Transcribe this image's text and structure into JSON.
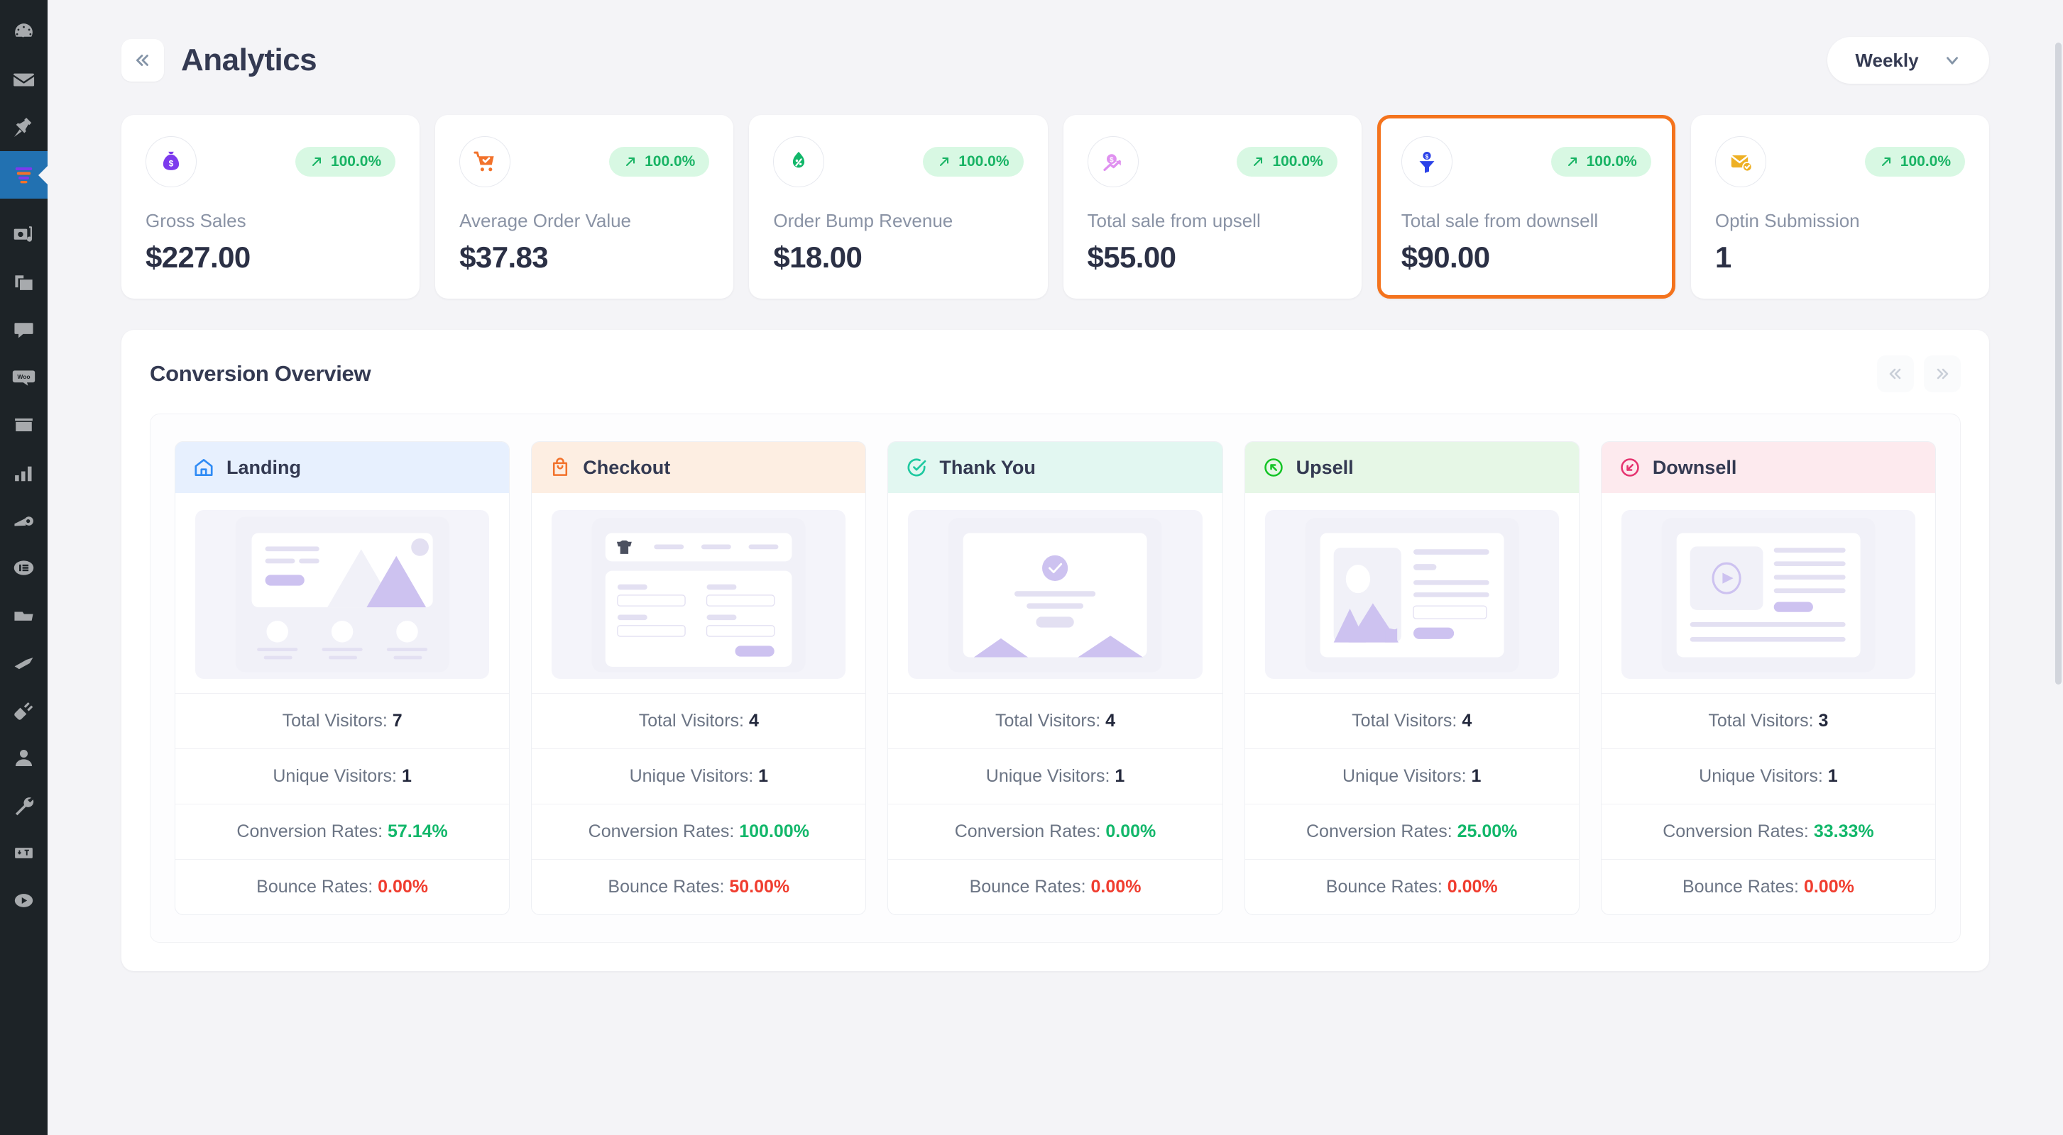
{
  "wp_sidebar": {
    "items": [
      {
        "name": "dashboard-icon",
        "active": false
      },
      {
        "name": "mail-icon",
        "active": false
      },
      {
        "name": "pin-icon",
        "active": false
      },
      {
        "name": "funnel-icon",
        "active": true
      },
      {
        "name": "media-icon",
        "active": false
      },
      {
        "name": "pages-icon",
        "active": false
      },
      {
        "name": "comments-icon",
        "active": false
      },
      {
        "name": "woo-icon",
        "active": false
      },
      {
        "name": "products-icon",
        "active": false
      },
      {
        "name": "analytics-icon",
        "active": false
      },
      {
        "name": "marketing-icon",
        "active": false
      },
      {
        "name": "elementor-icon",
        "active": false
      },
      {
        "name": "templates-icon",
        "active": false
      },
      {
        "name": "appearance-icon",
        "active": false
      },
      {
        "name": "plugins-icon",
        "active": false
      },
      {
        "name": "users-icon",
        "active": false
      },
      {
        "name": "tools-icon",
        "active": false
      },
      {
        "name": "settings-icon",
        "active": false
      },
      {
        "name": "play-icon",
        "active": false
      }
    ]
  },
  "header": {
    "title": "Analytics",
    "collapse_icon": "chevrons-left-icon",
    "period": {
      "value": "Weekly",
      "chevron_icon": "chevron-down-icon"
    }
  },
  "stats": {
    "cards": [
      {
        "label": "Gross Sales",
        "value": "$227.00",
        "badge": "100.0%",
        "badge_icon": "trend-up-icon",
        "icon": "money-bag-icon",
        "icon_color": "#7c3aed",
        "highlighted": false
      },
      {
        "label": "Average Order Value",
        "value": "$37.83",
        "badge": "100.0%",
        "badge_icon": "trend-up-icon",
        "icon": "cart-check-icon",
        "icon_color": "#f2722b",
        "highlighted": false
      },
      {
        "label": "Order Bump Revenue",
        "value": "$18.00",
        "badge": "100.0%",
        "badge_icon": "trend-up-icon",
        "icon": "leaf-percent-icon",
        "icon_color": "#12b76a",
        "highlighted": false
      },
      {
        "label": "Total sale from upsell",
        "value": "$55.00",
        "badge": "100.0%",
        "badge_icon": "trend-up-icon",
        "icon": "coin-trend-up-icon",
        "icon_color": "#e091f0",
        "highlighted": false
      },
      {
        "label": "Total sale from downsell",
        "value": "$90.00",
        "badge": "100.0%",
        "badge_icon": "trend-up-icon",
        "icon": "funnel-dollar-icon",
        "icon_color": "#2b42e8",
        "highlighted": true
      },
      {
        "label": "Optin Submission",
        "value": "1",
        "badge": "100.0%",
        "badge_icon": "trend-up-icon",
        "icon": "mail-check-icon",
        "icon_color": "#eeb024",
        "highlighted": false
      }
    ]
  },
  "conversion": {
    "title": "Conversion Overview",
    "nav": {
      "prev_icon": "chevrons-left-icon",
      "next_icon": "chevrons-right-icon"
    },
    "stat_labels": {
      "total_visitors": "Total Visitors:",
      "unique_visitors": "Unique Visitors:",
      "conversion_rates": "Conversion Rates:",
      "bounce_rates": "Bounce Rates:"
    },
    "steps": [
      {
        "label": "Landing",
        "icon": "home-icon",
        "accent": "#2f8bf5",
        "header_bg": "#e7f0fe",
        "thumb": "landing-wireframe",
        "total_visitors": "7",
        "unique_visitors": "1",
        "conversion_rate": "57.14%",
        "bounce_rate": "0.00%"
      },
      {
        "label": "Checkout",
        "icon": "shopping-bag-icon",
        "accent": "#f2722b",
        "header_bg": "#fdeee2",
        "thumb": "checkout-wireframe",
        "total_visitors": "4",
        "unique_visitors": "1",
        "conversion_rate": "100.00%",
        "bounce_rate": "50.00%"
      },
      {
        "label": "Thank You",
        "icon": "check-circle-icon",
        "accent": "#1ec9a0",
        "header_bg": "#e2f7f1",
        "thumb": "thankyou-wireframe",
        "total_visitors": "4",
        "unique_visitors": "1",
        "conversion_rate": "0.00%",
        "bounce_rate": "0.00%"
      },
      {
        "label": "Upsell",
        "icon": "arrow-up-circle-icon",
        "accent": "#14c426",
        "header_bg": "#e6f7e6",
        "thumb": "upsell-wireframe",
        "total_visitors": "4",
        "unique_visitors": "1",
        "conversion_rate": "25.00%",
        "bounce_rate": "0.00%"
      },
      {
        "label": "Downsell",
        "icon": "arrow-down-circle-icon",
        "accent": "#e5336f",
        "header_bg": "#fdeaee",
        "thumb": "downsell-wireframe",
        "total_visitors": "3",
        "unique_visitors": "1",
        "conversion_rate": "33.33%",
        "bounce_rate": "0.00%"
      }
    ]
  }
}
